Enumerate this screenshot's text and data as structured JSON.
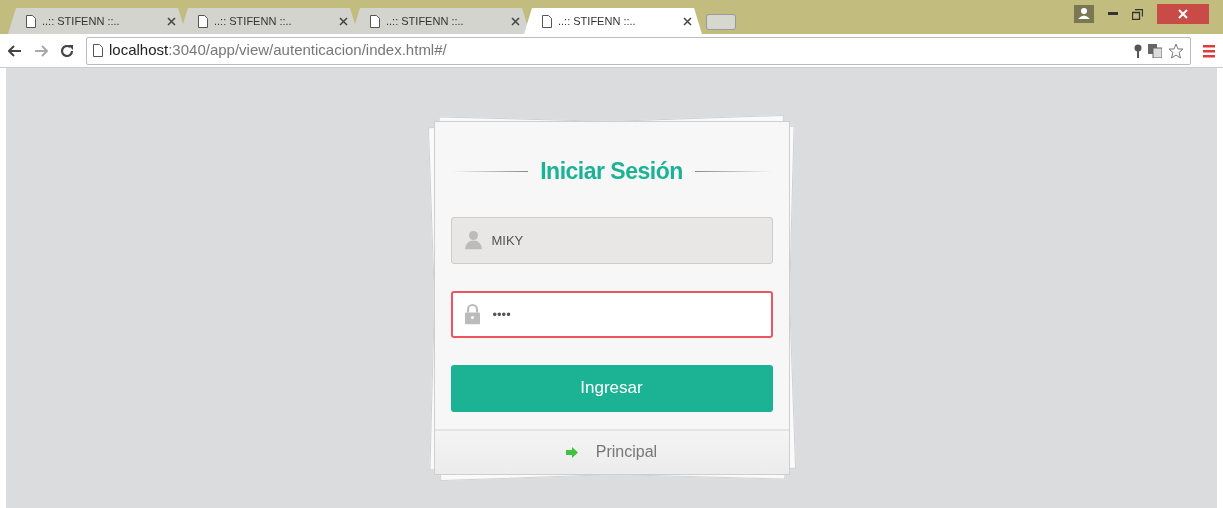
{
  "browser": {
    "tabs": [
      {
        "title": "..:: STIFENN ::..",
        "selected": false
      },
      {
        "title": "..:: STIFENN ::..",
        "selected": false
      },
      {
        "title": "..:: STIFENN ::..",
        "selected": false
      },
      {
        "title": "..:: STIFENN ::..",
        "selected": true
      }
    ],
    "address": {
      "host": "localhost",
      "path": ":3040/app/view/autenticacion/index.html#/"
    }
  },
  "login": {
    "title": "Iniciar Sesión",
    "fields": [
      {
        "kind": "user",
        "value": "MIKY",
        "disabled": true,
        "invalid": false
      },
      {
        "kind": "password",
        "value": "••••",
        "disabled": false,
        "invalid": true
      }
    ],
    "submit": "Ingresar",
    "footer_link": "Principal"
  }
}
